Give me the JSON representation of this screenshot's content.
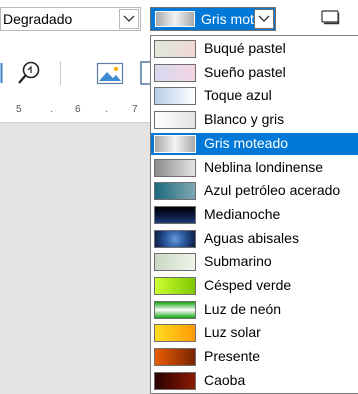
{
  "toolbar": {
    "fill_type_value": "Degradado",
    "gradient_value": "Gris moteado"
  },
  "ruler": {
    "labels": [
      "5",
      "6",
      "7"
    ]
  },
  "gradients": [
    {
      "label": "Buqué pastel",
      "c1": "#dfe8d7",
      "c2": "#f1d7d7"
    },
    {
      "label": "Sueño pastel",
      "c1": "#d7d9ef",
      "c2": "#f3d5e4"
    },
    {
      "label": "Toque azul",
      "c1": "#b7cdea",
      "c2": "#ffffff"
    },
    {
      "label": "Blanco y gris",
      "c1": "#ffffff",
      "c2": "#e4e4e4"
    },
    {
      "label": "Gris moteado",
      "c1": "#a9a9a9",
      "c2": "#f3f3f3"
    },
    {
      "label": "Neblina londinense",
      "c1": "#8a8a8a",
      "c2": "#e6e6e6"
    },
    {
      "label": "Azul petróleo acerado",
      "c1": "#1d6a7e",
      "c2": "#7fa7b2"
    },
    {
      "label": "Medianoche",
      "c1": "#0a1d44",
      "c2": "#000000"
    },
    {
      "label": "Aguas abisales",
      "c1": "#2f5fa8",
      "c2": "#0a1b3e"
    },
    {
      "label": "Submarino",
      "c1": "#c9d8c3",
      "c2": "#eef4e9"
    },
    {
      "label": "Césped verde",
      "c1": "#ccff33",
      "c2": "#7ec800"
    },
    {
      "label": "Luz de neón",
      "c1": "#ffffff",
      "c2": "#0fa30f"
    },
    {
      "label": "Luz solar",
      "c1": "#ffdd22",
      "c2": "#ff9a00"
    },
    {
      "label": "Presente",
      "c1": "#e85d04",
      "c2": "#7a2500"
    },
    {
      "label": "Caoba",
      "c1": "#2a0000",
      "c2": "#8a1a00"
    }
  ],
  "selected_index": 4
}
